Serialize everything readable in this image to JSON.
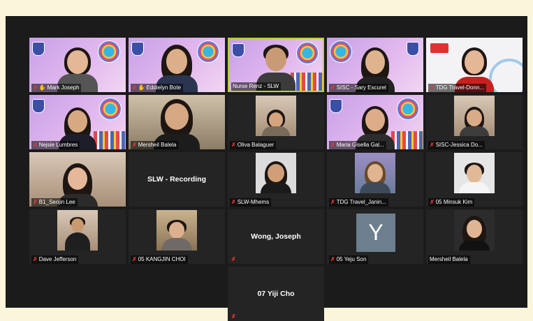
{
  "participants": [
    {
      "name": "Mark Joseph",
      "muted": true,
      "hand": true
    },
    {
      "name": "Eddielyn Bote",
      "muted": true,
      "hand": true
    },
    {
      "name": "Nurse Renz - SLW",
      "muted": false,
      "hand": false,
      "active": true
    },
    {
      "name": "SISC - Sary Escurel",
      "muted": true,
      "hand": false
    },
    {
      "name": "TDG Travel-Donn...",
      "muted": true,
      "hand": false
    },
    {
      "name": "Nejsie Lumbres",
      "muted": true,
      "hand": false
    },
    {
      "name": "Mersheil Balela",
      "muted": true,
      "hand": false
    },
    {
      "name": "Oliva Balaguer",
      "muted": true,
      "hand": false
    },
    {
      "name": "Maria Gisella Gal...",
      "muted": true,
      "hand": false
    },
    {
      "name": "SISC-Jessica Do...",
      "muted": true,
      "hand": false
    },
    {
      "name": "B1_Seojin Lee",
      "muted": true,
      "hand": false
    },
    {
      "name": "SLW - Recording",
      "muted": false,
      "hand": false,
      "no_video": true
    },
    {
      "name": "SLW-Mhems",
      "muted": true,
      "hand": false
    },
    {
      "name": "TDG Travel_Janin...",
      "muted": true,
      "hand": false
    },
    {
      "name": "05 Minsuk Kim",
      "muted": true,
      "hand": false
    },
    {
      "name": "Dave Jefferson",
      "muted": true,
      "hand": false
    },
    {
      "name": "05 KANGJIN CHOI",
      "muted": true,
      "hand": false
    },
    {
      "name": "Wong, Joseph",
      "muted": true,
      "hand": false,
      "no_video": true
    },
    {
      "name": "05 Yeju Son",
      "muted": true,
      "hand": false,
      "avatar_letter": "Y"
    },
    {
      "name": "Mersheil Balela",
      "muted": false,
      "hand": false
    },
    {
      "name": "07 Yiji Cho",
      "muted": true,
      "hand": false,
      "no_video": true
    }
  ],
  "icons": {
    "mic_muted": "mic-muted-icon",
    "raised_hand": "raised-hand-icon"
  },
  "colors": {
    "active_border": "#b6d13a",
    "muted_icon": "#e53935",
    "tile_bg": "#242424",
    "page_bg": "#fbf5dc"
  }
}
